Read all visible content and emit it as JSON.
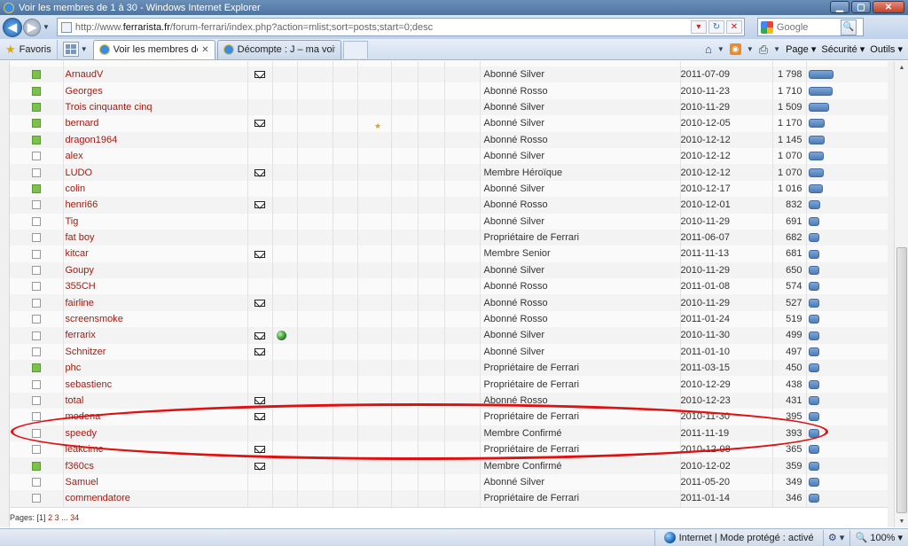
{
  "window": {
    "title": "Voir les membres de 1 à 30 - Windows Internet Explorer",
    "minimize": "▁",
    "maximize": "▢",
    "close": "✕"
  },
  "address": {
    "url_prefix": "http://www.",
    "url_domain": "ferrarista.fr",
    "url_rest": "/forum-ferrari/index.php?action=mlist;sort=posts;start=0;desc",
    "search_placeholder": "Google"
  },
  "favorites": {
    "label": "Favoris",
    "tabs": [
      {
        "label": "Voir les membres de 1 ...",
        "active": true
      },
      {
        "label": "Décompte : J – ma voiture ...",
        "active": false
      }
    ],
    "commands": {
      "page": "Page",
      "security": "Sécurité",
      "tools": "Outils"
    }
  },
  "members": [
    {
      "name": "ArnaudV",
      "online": true,
      "pm": true,
      "www": false,
      "rank": "Abonné Silver",
      "date": "2011-07-09",
      "posts": "1 798",
      "posts_value": 1798
    },
    {
      "name": "Georges",
      "online": true,
      "pm": false,
      "www": false,
      "rank": "Abonné Rosso",
      "date": "2010-11-23",
      "posts": "1 710",
      "posts_value": 1710
    },
    {
      "name": "Trois cinquante cinq",
      "online": true,
      "pm": false,
      "www": false,
      "rank": "Abonné Silver",
      "date": "2010-11-29",
      "posts": "1 509",
      "posts_value": 1509
    },
    {
      "name": "bernard",
      "online": true,
      "pm": true,
      "www": false,
      "rank": "Abonné Silver",
      "date": "2010-12-05",
      "posts": "1 170",
      "posts_value": 1170
    },
    {
      "name": "dragon1964",
      "online": true,
      "pm": false,
      "www": false,
      "rank": "Abonné Rosso",
      "date": "2010-12-12",
      "posts": "1 145",
      "posts_value": 1145
    },
    {
      "name": "alex",
      "online": false,
      "pm": false,
      "www": false,
      "rank": "Abonné Silver",
      "date": "2010-12-12",
      "posts": "1 070",
      "posts_value": 1070
    },
    {
      "name": "LUDO",
      "online": false,
      "pm": true,
      "www": false,
      "rank": "Membre Héroïque",
      "date": "2010-12-12",
      "posts": "1 070",
      "posts_value": 1070
    },
    {
      "name": "colin",
      "online": true,
      "pm": false,
      "www": false,
      "rank": "Abonné Silver",
      "date": "2010-12-17",
      "posts": "1 016",
      "posts_value": 1016
    },
    {
      "name": "henri66",
      "online": false,
      "pm": true,
      "www": false,
      "rank": "Abonné Rosso",
      "date": "2010-12-01",
      "posts": "832",
      "posts_value": 832
    },
    {
      "name": "Tig",
      "online": false,
      "pm": false,
      "www": false,
      "rank": "Abonné Silver",
      "date": "2010-11-29",
      "posts": "691",
      "posts_value": 691
    },
    {
      "name": "fat boy",
      "online": false,
      "pm": false,
      "www": false,
      "rank": "Propriétaire de Ferrari",
      "date": "2011-06-07",
      "posts": "682",
      "posts_value": 682
    },
    {
      "name": "kitcar",
      "online": false,
      "pm": true,
      "www": false,
      "rank": "Membre Senior",
      "date": "2011-11-13",
      "posts": "681",
      "posts_value": 681
    },
    {
      "name": "Goupy",
      "online": false,
      "pm": false,
      "www": false,
      "rank": "Abonné Silver",
      "date": "2010-11-29",
      "posts": "650",
      "posts_value": 650
    },
    {
      "name": "355CH",
      "online": false,
      "pm": false,
      "www": false,
      "rank": "Abonné Rosso",
      "date": "2011-01-08",
      "posts": "574",
      "posts_value": 574
    },
    {
      "name": "fairline",
      "online": false,
      "pm": true,
      "www": false,
      "rank": "Abonné Rosso",
      "date": "2010-11-29",
      "posts": "527",
      "posts_value": 527
    },
    {
      "name": "screensmoke",
      "online": false,
      "pm": false,
      "www": false,
      "rank": "Abonné Rosso",
      "date": "2011-01-24",
      "posts": "519",
      "posts_value": 519
    },
    {
      "name": "ferrarix",
      "online": false,
      "pm": true,
      "www": true,
      "rank": "Abonné Silver",
      "date": "2010-11-30",
      "posts": "499",
      "posts_value": 499
    },
    {
      "name": "Schnitzer",
      "online": false,
      "pm": true,
      "www": false,
      "rank": "Abonné Silver",
      "date": "2011-01-10",
      "posts": "497",
      "posts_value": 497
    },
    {
      "name": "phc",
      "online": true,
      "pm": false,
      "www": false,
      "rank": "Propriétaire de Ferrari",
      "date": "2011-03-15",
      "posts": "450",
      "posts_value": 450
    },
    {
      "name": "sebastienc",
      "online": false,
      "pm": false,
      "www": false,
      "rank": "Propriétaire de Ferrari",
      "date": "2010-12-29",
      "posts": "438",
      "posts_value": 438
    },
    {
      "name": "total",
      "online": false,
      "pm": true,
      "www": false,
      "rank": "Abonné Rosso",
      "date": "2010-12-23",
      "posts": "431",
      "posts_value": 431
    },
    {
      "name": "modena",
      "online": false,
      "pm": true,
      "www": false,
      "rank": "Propriétaire de Ferrari",
      "date": "2010-11-30",
      "posts": "395",
      "posts_value": 395
    },
    {
      "name": "speedy",
      "online": false,
      "pm": false,
      "www": false,
      "rank": "Membre Confirmé",
      "date": "2011-11-19",
      "posts": "393",
      "posts_value": 393
    },
    {
      "name": "leakcimc",
      "online": false,
      "pm": true,
      "www": false,
      "rank": "Propriétaire de Ferrari",
      "date": "2010-12-08",
      "posts": "365",
      "posts_value": 365
    },
    {
      "name": "f360cs",
      "online": true,
      "pm": true,
      "www": false,
      "rank": "Membre Confirmé",
      "date": "2010-12-02",
      "posts": "359",
      "posts_value": 359
    },
    {
      "name": "Samuel",
      "online": false,
      "pm": false,
      "www": false,
      "rank": "Abonné Silver",
      "date": "2011-05-20",
      "posts": "349",
      "posts_value": 349
    },
    {
      "name": "commendatore",
      "online": false,
      "pm": false,
      "www": false,
      "rank": "Propriétaire de Ferrari",
      "date": "2011-01-14",
      "posts": "346",
      "posts_value": 346
    }
  ],
  "pagination": {
    "label": "Pages:",
    "current": "[1]",
    "pages": [
      "2",
      "3",
      "...",
      "34"
    ]
  },
  "status": {
    "zone": "Internet | Mode protégé : activé",
    "zoom": "100%"
  },
  "colors": {
    "member_link": "#9d1a10",
    "online": "#7cc24a",
    "highlight_ellipse": "#e01010",
    "post_bar": "#4e7cb6"
  }
}
